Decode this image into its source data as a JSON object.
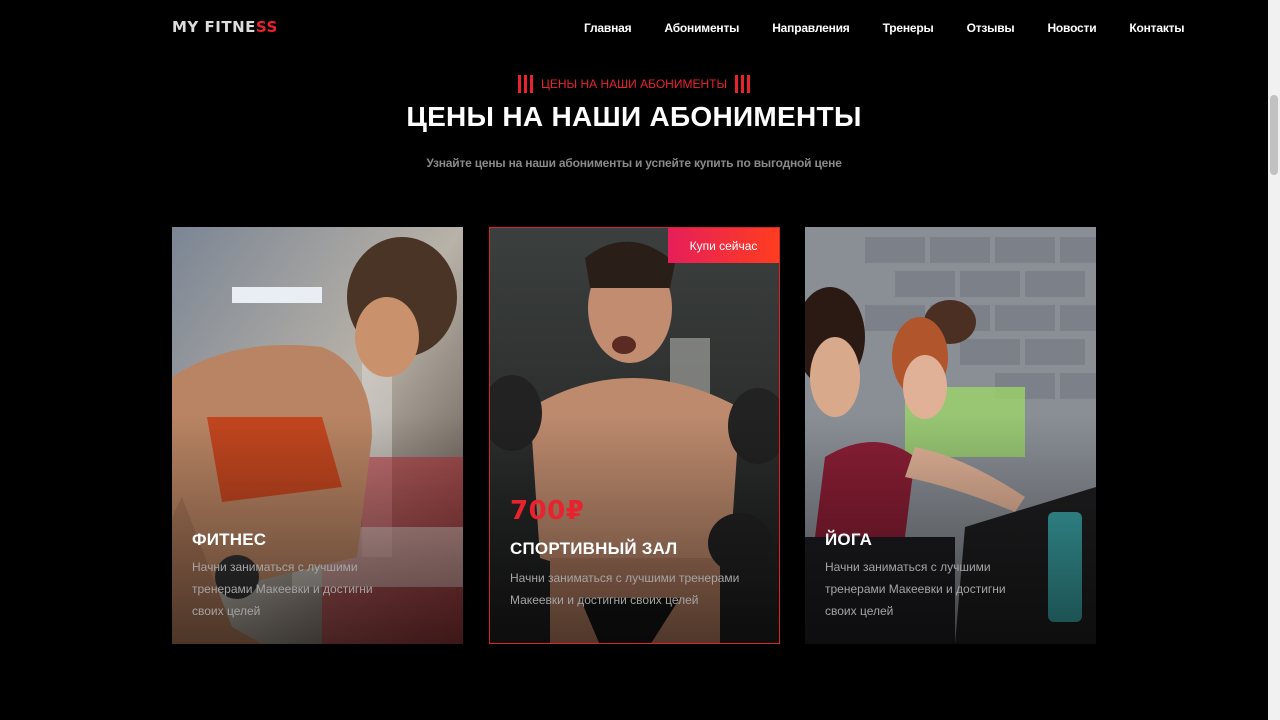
{
  "header": {
    "logo": {
      "main": "MY FITNE",
      "accent": "SS"
    },
    "nav": [
      "Главная",
      "Абонименты",
      "Направления",
      "Тренеры",
      "Отзывы",
      "Новости",
      "Контакты"
    ]
  },
  "section": {
    "subtitle": "ЦЕНЫ НА НАШИ АБОНИМЕНТЫ",
    "title": "ЦЕНЫ НА НАШИ АБОНИМЕНТЫ",
    "description": "Узнайте цены на наши абонименты и успейте купить по выгодной цене"
  },
  "cards": [
    {
      "name": "ФИТНЕС",
      "desc": "Начни заниматься с лучшими тренерами Макеевки и достигни своих целей"
    },
    {
      "name": "СПОРТИВНЫЙ ЗАЛ",
      "price": "700₽",
      "desc": "Начни заниматься с лучшими тренерами Макеевки и достигни своих целей",
      "button": "Купи сейчас"
    },
    {
      "name": "ЙОГА",
      "desc": "Начни заниматься с лучшими тренерами Макеевки и достигни своих целей"
    }
  ],
  "colors": {
    "accent": "#e8232e",
    "button_start": "#e61e5a",
    "button_end": "#ff3d1f"
  }
}
